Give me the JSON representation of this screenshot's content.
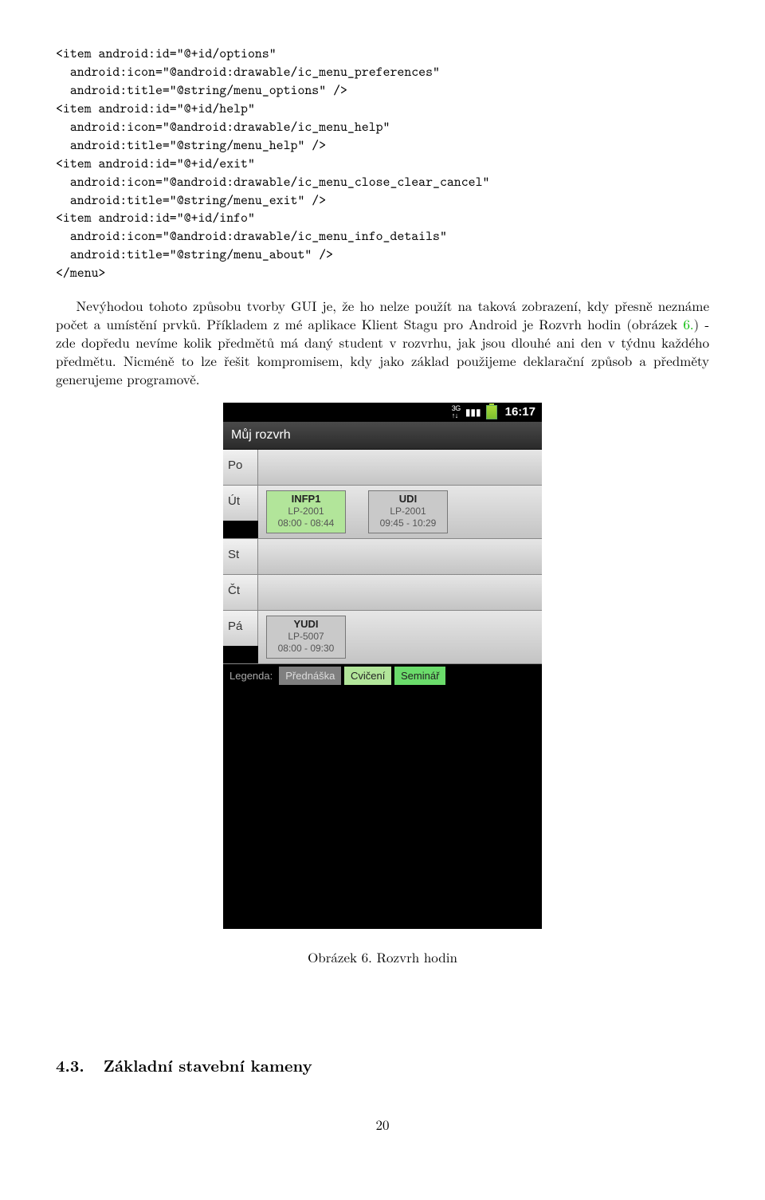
{
  "code_lines": [
    "<item android:id=\"@+id/options\"",
    "  android:icon=\"@android:drawable/ic_menu_preferences\"",
    "  android:title=\"@string/menu_options\" />",
    "<item android:id=\"@+id/help\"",
    "  android:icon=\"@android:drawable/ic_menu_help\"",
    "  android:title=\"@string/menu_help\" />",
    "<item android:id=\"@+id/exit\"",
    "  android:icon=\"@android:drawable/ic_menu_close_clear_cancel\"",
    "  android:title=\"@string/menu_exit\" />",
    "<item android:id=\"@+id/info\"",
    "  android:icon=\"@android:drawable/ic_menu_info_details\"",
    "  android:title=\"@string/menu_about\" />",
    "</menu>"
  ],
  "paragraph": "Nevýhodou tohoto způsobu tvorby GUI je, že ho nelze použít na taková zobrazení, kdy přesně neznáme počet a umístění prvků. Příkladem z mé aplikace Klient Stagu pro Android je Rozvrh hodin (obrázek ",
  "figref": "6.",
  "paragraph_tail": ") - zde dopředu nevíme kolik předmětů má daný student v rozvrhu, jak jsou dlouhé ani den v týdnu každého předmětu. Nicméně to lze řešit kompromisem, kdy jako základ použijeme deklarační způsob a předměty generujeme programově.",
  "phone": {
    "status_time": "16:17",
    "title": "Můj rozvrh",
    "days": [
      "Po",
      "Út",
      "St",
      "Čt",
      "Pá"
    ],
    "ut_cards": [
      {
        "name": "INFP1",
        "room": "LP-2001",
        "time": "08:00 - 08:44",
        "klass": "cv"
      },
      {
        "name": "UDI",
        "room": "LP-2001",
        "time": "09:45 - 10:29",
        "klass": "pr"
      }
    ],
    "pa_cards": [
      {
        "name": "YUDI",
        "room": "LP-5007",
        "time": "08:00 - 09:30",
        "klass": "pr"
      }
    ],
    "legend_label": "Legenda:",
    "legend_items": [
      {
        "label": "Přednáška",
        "klass": "pr"
      },
      {
        "label": "Cvičení",
        "klass": "cv"
      },
      {
        "label": "Seminář",
        "klass": "se"
      }
    ]
  },
  "caption": "Obrázek 6. Rozvrh hodin",
  "section_num": "4.3.",
  "section_title": "Základní stavební kameny",
  "page": "20"
}
